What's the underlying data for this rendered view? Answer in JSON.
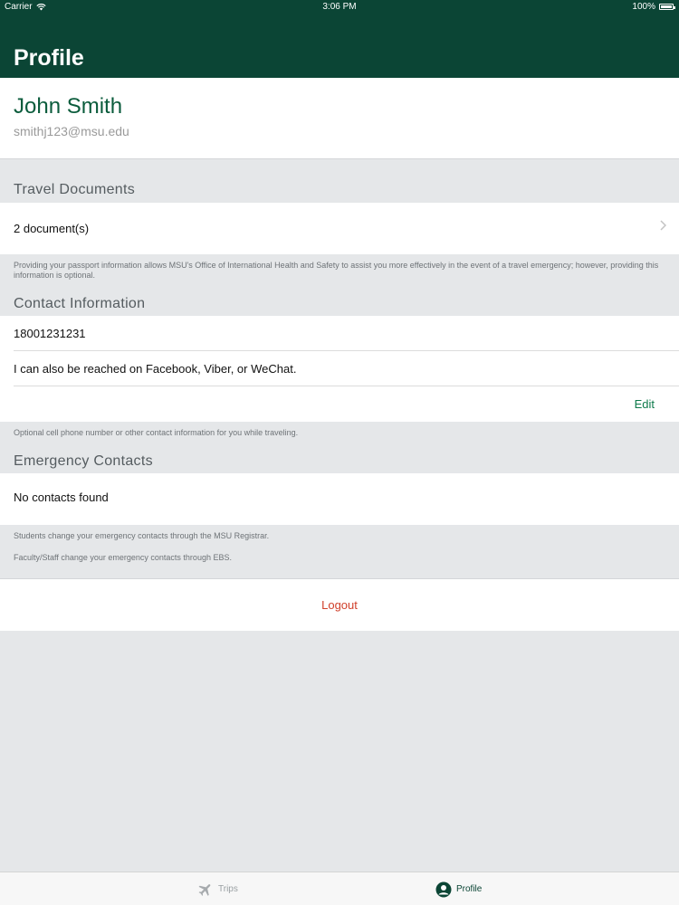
{
  "status_bar": {
    "carrier": "Carrier",
    "time": "3:06 PM",
    "battery": "100%"
  },
  "header": {
    "title": "Profile"
  },
  "user": {
    "name": "John Smith",
    "email": "smithj123@msu.edu"
  },
  "travel_documents": {
    "heading": "Travel Documents",
    "row_label": "2 document(s)",
    "footnote": "Providing your passport information allows MSU's Office of International Health and Safety to assist you more effectively in the event of a travel emergency; however, providing this information is optional."
  },
  "contact_information": {
    "heading": "Contact Information",
    "phone": "18001231231",
    "other": "I can also be reached on Facebook, Viber, or WeChat.",
    "edit_label": "Edit",
    "footnote": "Optional cell phone number or other contact information for you while traveling."
  },
  "emergency_contacts": {
    "heading": "Emergency Contacts",
    "empty_label": "No contacts found",
    "footnote_students": "Students change your emergency contacts through the MSU Registrar.",
    "footnote_staff": "Faculty/Staff change your emergency contacts through EBS."
  },
  "logout_label": "Logout",
  "tabs": [
    {
      "label": "Trips",
      "icon": "airplane-icon",
      "active": false
    },
    {
      "label": "Profile",
      "icon": "person-icon",
      "active": true
    }
  ],
  "colors": {
    "header": "#0b4535",
    "accent": "#0e7a4b",
    "logout": "#d0402b"
  }
}
